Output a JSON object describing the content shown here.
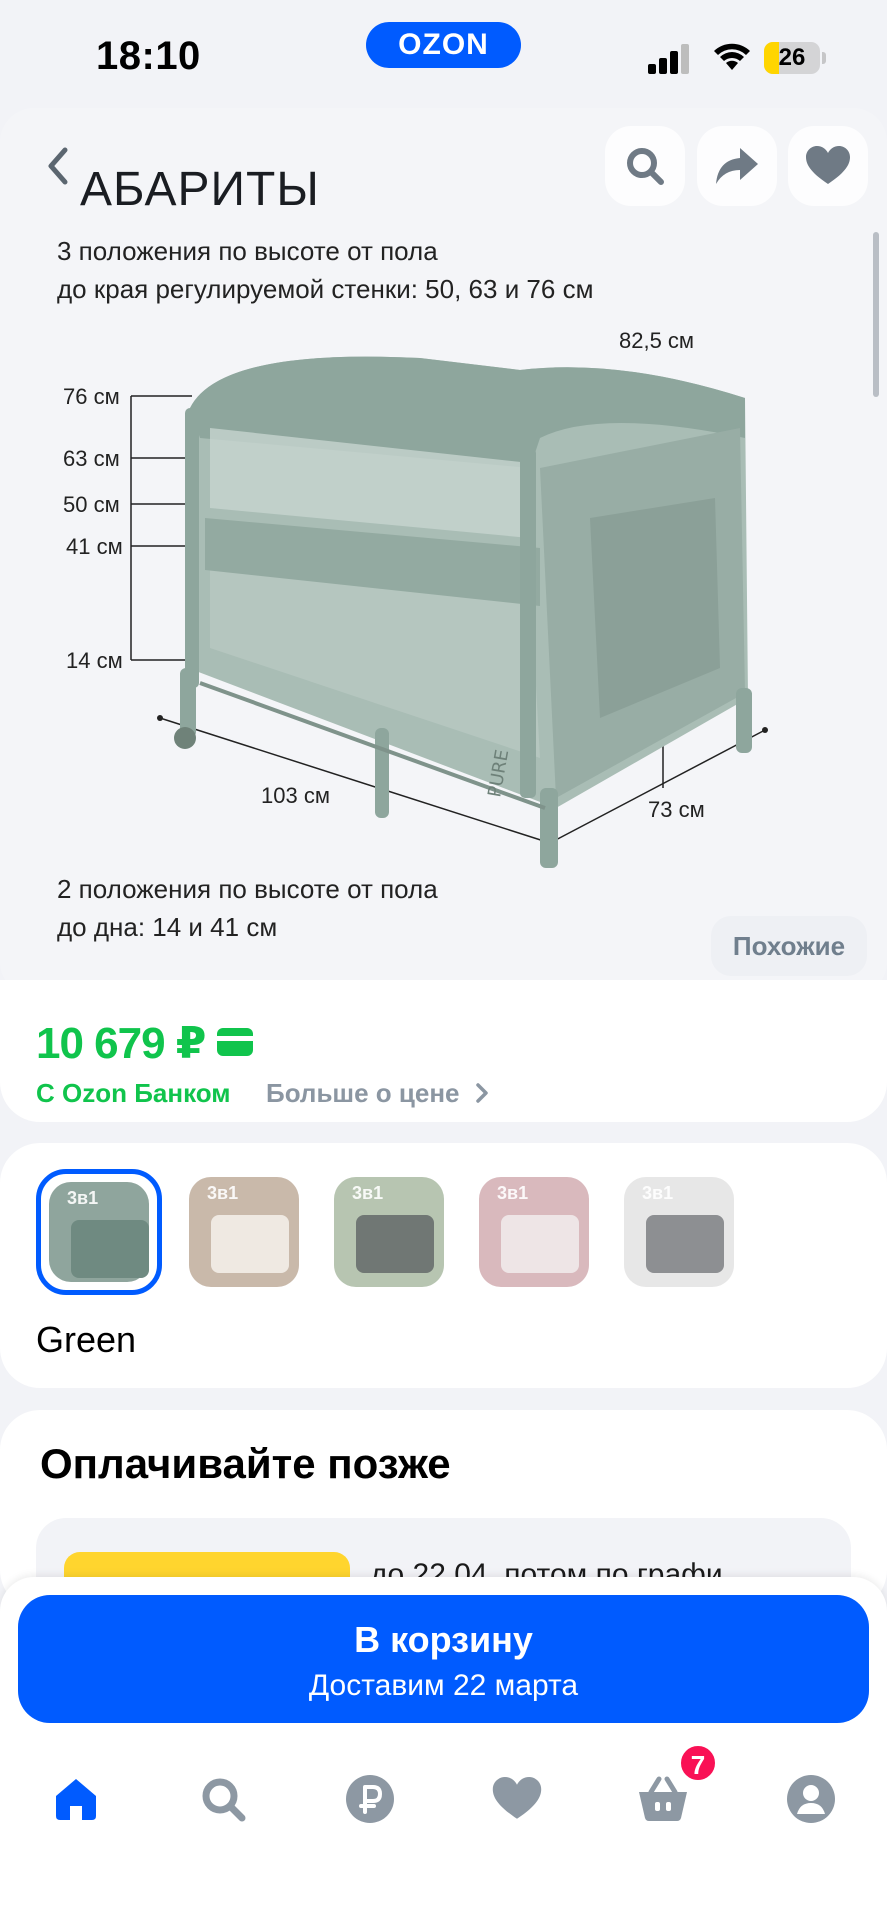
{
  "status_bar": {
    "time": "18:10",
    "brand": "OZON",
    "battery": "26",
    "battery_level": 0.26
  },
  "image": {
    "title": "АБАРИТЫ",
    "desc1_line1": "3 положения по высоте от пола",
    "desc1_line2": "до края регулируемой стенки: 50, 63 и 76 см",
    "desc2_line1": "2 положения по высоте от пола",
    "desc2_line2": "до дна: 14 и 41 см",
    "dims": {
      "h76": "76 см",
      "h63": "63 см",
      "h50": "50 см",
      "h41": "41 см",
      "h14": "14 см",
      "height_total": "82,5 см",
      "length": "103 см",
      "width": "73 см"
    },
    "similar_label": "Похожие",
    "crib_side_text": "PURE"
  },
  "price": {
    "value": "10 679 ₽",
    "bank_label": "С Ozon Банком",
    "more_label": "Больше о цене"
  },
  "variants": {
    "items": [
      {
        "label": "3в1",
        "bg": "#8fa59d",
        "crib": "#6f8a81"
      },
      {
        "label": "3в1",
        "bg": "#c9b9aa",
        "crib": "#efe9e2"
      },
      {
        "label": "3в1",
        "bg": "#b7c5b1",
        "crib": "#707774"
      },
      {
        "label": "3в1",
        "bg": "#d9b9bd",
        "crib": "#eee5e6"
      },
      {
        "label": "3в1",
        "bg": "#e7e7e7",
        "crib": "#8d8f92"
      }
    ],
    "selected_color": "Green"
  },
  "paylater": {
    "title": "Оплачивайте позже",
    "text": "до 22.04, потом по графи"
  },
  "cart": {
    "label": "В корзину",
    "delivery": "Доставим 22 марта"
  },
  "tabbar": {
    "icons": [
      "home-icon",
      "search-icon",
      "ruble-icon",
      "heart-icon",
      "basket-icon",
      "profile-icon"
    ],
    "cart_count": "7"
  },
  "colors": {
    "accent": "#005bff",
    "price_green": "#10c44c",
    "badge": "#f91155"
  }
}
